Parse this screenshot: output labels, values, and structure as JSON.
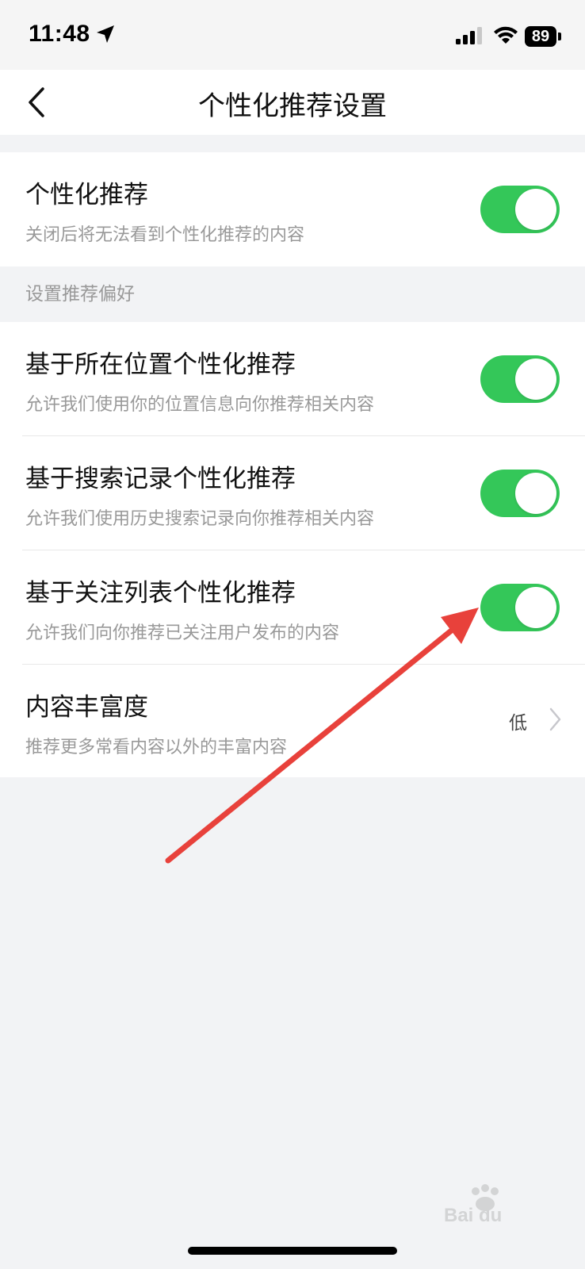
{
  "status_bar": {
    "time": "11:48",
    "battery": "89"
  },
  "nav": {
    "title": "个性化推荐设置"
  },
  "main_toggle": {
    "title": "个性化推荐",
    "subtitle": "关闭后将无法看到个性化推荐的内容",
    "on": true
  },
  "section": {
    "label": "设置推荐偏好"
  },
  "items": [
    {
      "title": "基于所在位置个性化推荐",
      "subtitle": "允许我们使用你的位置信息向你推荐相关内容",
      "on": true
    },
    {
      "title": "基于搜索记录个性化推荐",
      "subtitle": "允许我们使用历史搜索记录向你推荐相关内容",
      "on": true
    },
    {
      "title": "基于关注列表个性化推荐",
      "subtitle": "允许我们向你推荐已关注用户发布的内容",
      "on": true
    }
  ],
  "richness": {
    "title": "内容丰富度",
    "subtitle": "推荐更多常看内容以外的丰富内容",
    "value": "低"
  },
  "colors": {
    "toggle_on": "#34c759",
    "annotation_arrow": "#e8413b"
  }
}
